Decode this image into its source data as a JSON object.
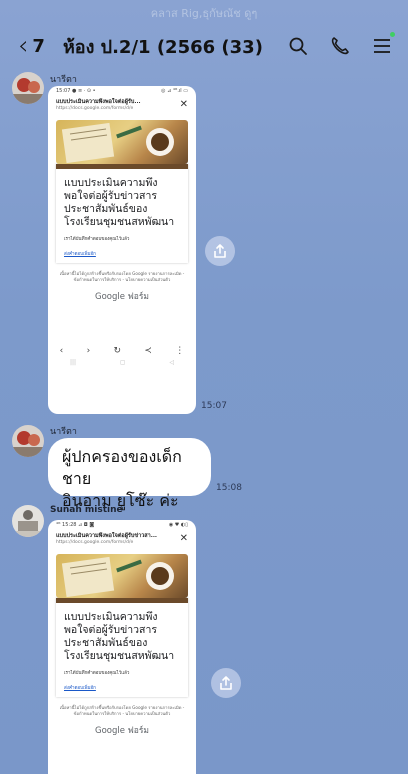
{
  "header": {
    "faded_text": "คลาส Rig,ธุกัษณัช ดูๆ",
    "back_count": "7",
    "title": "ห้อง ป.2/1 (2566 (33)",
    "icons": [
      "search-icon",
      "phone-icon",
      "menu-icon"
    ]
  },
  "messages": [
    {
      "sender": "นารีตา",
      "time": "15:07",
      "type": "image",
      "shot": {
        "status_left": "15:07 ● ≡ · ⊙ •",
        "status_right": "◎ ⊿ ⁴ᴳ.ıl ▭",
        "page_title": "แบบประเมินความพึงพอใจต่อผู้รับ...",
        "url": "https://docs.google.com/forms/d/e",
        "form_title": "แบบประเมินความพึงพอใจต่อผู้รับข่าวสารประชาสัมพันธ์ของโรงเรียนชุมชนสหพัฒนา",
        "form_subtitle": "เราได้บันทึกคำตอบของคุณไว้แล้ว",
        "form_link": "ส่งคำตอบเพิ่มอีก",
        "disclaimer": "เนื้อหานี้ไม่ได้ถูกสร้างขึ้นหรือรับรองโดย Google รายงานการละเมิด - ข้อกำหนดในการให้บริการ - นโยบายความเป็นส่วนตัว",
        "brand": "Google ฟอร์ม"
      }
    },
    {
      "sender": "นารีตา",
      "time": "15:08",
      "type": "text",
      "text_line1": "ผู้ปกครองของเด็กชาย",
      "text_line2": "อินอาม ยูโซ๊ะ ค่ะ"
    },
    {
      "sender": "Sunah mistine",
      "type": "image",
      "shot": {
        "status_left": "⁴ᴳ 15:28 ⊿ ◘ ◙",
        "status_right": "◉ ♥ ◐▯",
        "page_title": "แบบประเมินความพึงพอใจต่อผู้รับข่าวสา...",
        "url": "https://docs.google.com/forms/d/e",
        "form_title": "แบบประเมินความพึงพอใจต่อผู้รับข่าวสารประชาสัมพันธ์ของโรงเรียนชุมชนสหพัฒนา",
        "form_subtitle": "เราได้บันทึกคำตอบของคุณไว้แล้ว",
        "form_link": "ส่งคำตอบเพิ่มอีก",
        "disclaimer": "เนื้อหานี้ไม่ได้ถูกสร้างขึ้นหรือรับรองโดย Google รายงานการละเมิด - ข้อกำหนดในการให้บริการ - นโยบายความเป็นส่วนตัว",
        "brand": "Google ฟอร์ม"
      }
    }
  ]
}
